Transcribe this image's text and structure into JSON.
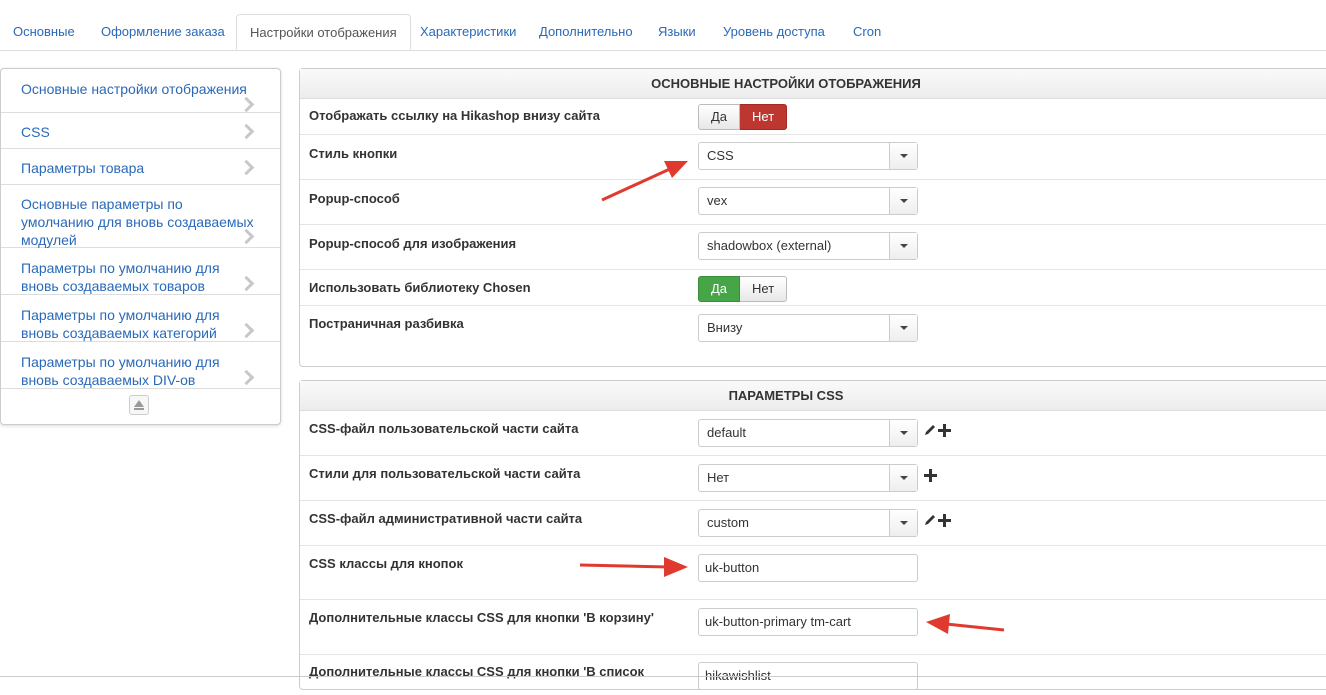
{
  "tabs": [
    {
      "label": "Основные"
    },
    {
      "label": "Оформление заказа"
    },
    {
      "label": "Настройки отображения"
    },
    {
      "label": "Характеристики"
    },
    {
      "label": "Дополнительно"
    },
    {
      "label": "Языки"
    },
    {
      "label": "Уровень доступа"
    },
    {
      "label": "Cron"
    }
  ],
  "sidebar": {
    "items": [
      {
        "label": "Основные настройки отображения"
      },
      {
        "label": "CSS"
      },
      {
        "label": "Параметры товара"
      },
      {
        "label": "Основные параметры по умолчанию для вновь создаваемых модулей"
      },
      {
        "label": "Параметры по умолчанию для вновь создаваемых товаров"
      },
      {
        "label": "Параметры по умолчанию для вновь создаваемых категорий"
      },
      {
        "label": "Параметры по умолчанию для вновь создаваемых DIV-ов"
      }
    ]
  },
  "display_panel": {
    "title": "ОСНОВНЫЕ НАСТРОЙКИ ОТОБРАЖЕНИЯ",
    "rows": {
      "footer_link": {
        "label": "Отображать ссылку на Hikashop внизу сайта",
        "yes": "Да",
        "no": "Нет",
        "selected": "no"
      },
      "button_style": {
        "label": "Стиль кнопки",
        "value": "CSS"
      },
      "popup": {
        "label": "Popup-способ",
        "value": "vex"
      },
      "popup_image": {
        "label": "Popup-способ для изображения",
        "value": "shadowbox (external)"
      },
      "chosen": {
        "label": "Использовать библиотеку Chosen",
        "yes": "Да",
        "no": "Нет",
        "selected": "yes"
      },
      "pagination": {
        "label": "Постраничная разбивка",
        "value": "Внизу"
      }
    }
  },
  "css_panel": {
    "title": "ПАРАМЕТРЫ CSS",
    "rows": {
      "frontend_css": {
        "label": "CSS-файл пользовательской части сайта",
        "value": "default"
      },
      "frontend_styles": {
        "label": "Стили для пользовательской части сайта",
        "value": "Нет"
      },
      "backend_css": {
        "label": "CSS-файл административной части сайта",
        "value": "custom"
      },
      "button_classes": {
        "label": "CSS классы для кнопок",
        "value": "uk-button"
      },
      "cart_classes": {
        "label": "Дополнительные классы CSS для кнопки 'В корзину'",
        "value": "uk-button-primary tm-cart"
      },
      "wishlist_classes": {
        "label": "Дополнительные классы CSS для кнопки 'В список",
        "value": "hikawishlist"
      }
    }
  },
  "colors": {
    "link": "#2a69b8",
    "no_active": "#bd362f",
    "yes_active": "#46a546",
    "annotation_arrow": "#e03a2f"
  }
}
